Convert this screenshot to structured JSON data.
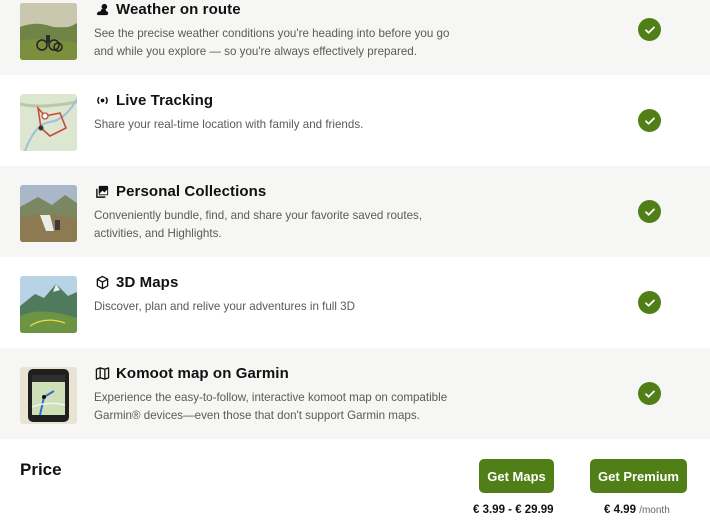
{
  "features": [
    {
      "title": "Weather on route",
      "icon": "weather-icon",
      "description": "See the precise weather conditions you're heading into before you go and while you explore — so you're always effectively prepared."
    },
    {
      "title": "Live Tracking",
      "icon": "live-tracking-icon",
      "description": "Share your real-time location with family and friends."
    },
    {
      "title": "Personal Collections",
      "icon": "collections-icon",
      "description": "Conveniently bundle, find, and share your favorite saved routes, activities, and Highlights."
    },
    {
      "title": "3D Maps",
      "icon": "cube-icon",
      "description": "Discover, plan and relive your adventures in full 3D"
    },
    {
      "title": "Komoot map on Garmin",
      "icon": "map-icon",
      "description": "Experience the easy-to-follow, interactive komoot map on compatible Garmin® devices—even those that don't support Garmin maps."
    }
  ],
  "price": {
    "label": "Price",
    "maps_button": "Get Maps",
    "premium_button": "Get Premium",
    "maps_price": "€ 3.99 - € 29.99",
    "premium_price": "€ 4.99",
    "premium_period": "/month"
  },
  "colors": {
    "accent": "#4f7f16",
    "alt_row": "#f6f6f4"
  }
}
